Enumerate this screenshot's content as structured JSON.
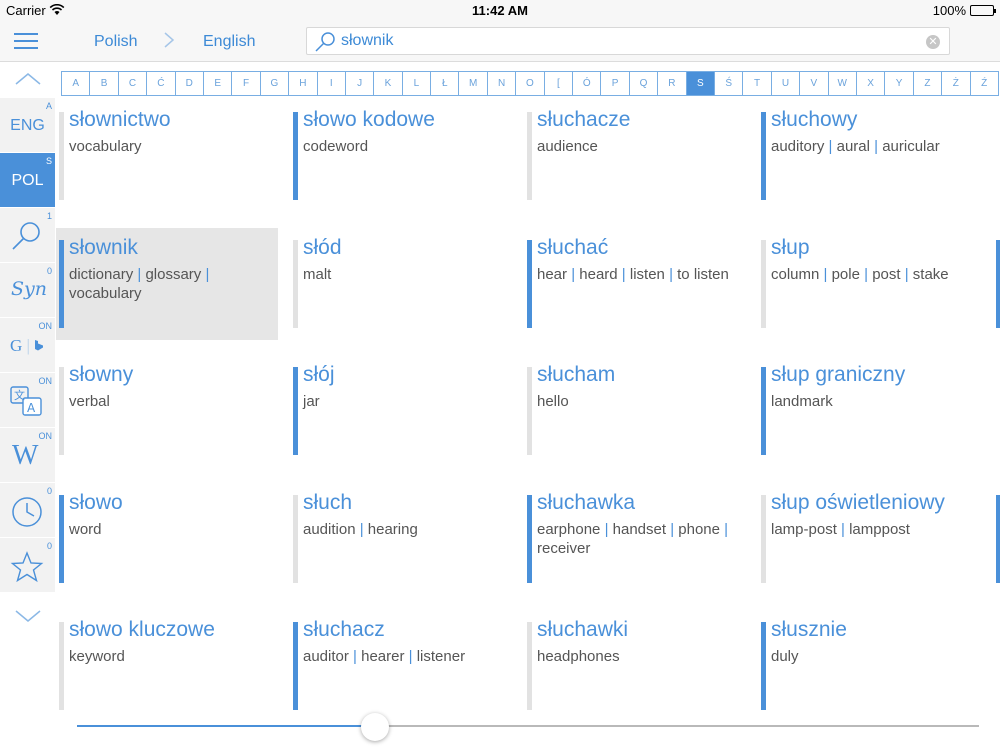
{
  "status_bar": {
    "carrier": "Carrier",
    "time": "11:42 AM",
    "battery": "100%"
  },
  "nav": {
    "source_lang": "Polish",
    "target_lang": "English"
  },
  "search": {
    "value": "słownik"
  },
  "letters": [
    "A",
    "B",
    "C",
    "Ć",
    "D",
    "E",
    "F",
    "G",
    "H",
    "I",
    "J",
    "K",
    "L",
    "Ł",
    "M",
    "N",
    "O",
    "[",
    "Ó",
    "P",
    "Q",
    "R",
    "S",
    "Ś",
    "T",
    "U",
    "V",
    "W",
    "X",
    "Y",
    "Z",
    "Ż",
    "Ź"
  ],
  "active_letter": "S",
  "sidebar": {
    "eng": {
      "label": "ENG",
      "badge": "A"
    },
    "pol": {
      "label": "POL",
      "badge": "S"
    },
    "search": {
      "badge": "1"
    },
    "syn": {
      "label": "Syn",
      "badge": "0"
    },
    "google_bing": {
      "label": "G",
      "badge": "ON"
    },
    "translate": {
      "badge": "ON"
    },
    "wiki": {
      "label": "W",
      "badge": "ON"
    },
    "history": {
      "badge": "0"
    },
    "favorites": {
      "badge": "0"
    }
  },
  "entries": [
    {
      "word": "słownictwo",
      "translations": [
        "vocabulary"
      ],
      "marked": false,
      "selected": false
    },
    {
      "word": "słowo kodowe",
      "translations": [
        "codeword"
      ],
      "marked": true,
      "selected": false
    },
    {
      "word": "słuchacze",
      "translations": [
        "audience"
      ],
      "marked": false,
      "selected": false
    },
    {
      "word": "słuchowy",
      "translations": [
        "auditory",
        "aural",
        "auricular"
      ],
      "marked": true,
      "selected": false
    },
    {
      "word": "słownik",
      "translations": [
        "dictionary",
        "glossary",
        "vocabulary"
      ],
      "marked": true,
      "selected": true
    },
    {
      "word": "słód",
      "translations": [
        "malt"
      ],
      "marked": false,
      "selected": false
    },
    {
      "word": "słuchać",
      "translations": [
        "hear",
        "heard",
        "listen",
        "to listen"
      ],
      "marked": true,
      "selected": false
    },
    {
      "word": "słup",
      "translations": [
        "column",
        "pole",
        "post",
        "stake"
      ],
      "marked": false,
      "selected": false
    },
    {
      "word": "słowny",
      "translations": [
        "verbal"
      ],
      "marked": false,
      "selected": false
    },
    {
      "word": "słój",
      "translations": [
        "jar"
      ],
      "marked": true,
      "selected": false
    },
    {
      "word": "słucham",
      "translations": [
        "hello"
      ],
      "marked": false,
      "selected": false
    },
    {
      "word": "słup graniczny",
      "translations": [
        "landmark"
      ],
      "marked": true,
      "selected": false
    },
    {
      "word": "słowo",
      "translations": [
        "word"
      ],
      "marked": true,
      "selected": false
    },
    {
      "word": "słuch",
      "translations": [
        "audition",
        "hearing"
      ],
      "marked": false,
      "selected": false
    },
    {
      "word": "słuchawka",
      "translations": [
        "earphone",
        "handset",
        "phone",
        "receiver"
      ],
      "marked": true,
      "selected": false
    },
    {
      "word": "słup oświetleniowy",
      "translations": [
        "lamp-post",
        "lamppost"
      ],
      "marked": false,
      "selected": false
    },
    {
      "word": "słowo kluczowe",
      "translations": [
        "keyword"
      ],
      "marked": false,
      "selected": false
    },
    {
      "word": "słuchacz",
      "translations": [
        "auditor",
        "hearer",
        "listener"
      ],
      "marked": true,
      "selected": false
    },
    {
      "word": "słuchawki",
      "translations": [
        "headphones"
      ],
      "marked": false,
      "selected": false
    },
    {
      "word": "słusznie",
      "translations": [
        "duly"
      ],
      "marked": true,
      "selected": false
    }
  ],
  "slider": {
    "value": 0.33
  },
  "colors": {
    "accent": "#4a90d9",
    "inactive_bar": "#e2e2e2",
    "selected_bg": "#e6e6e6"
  }
}
